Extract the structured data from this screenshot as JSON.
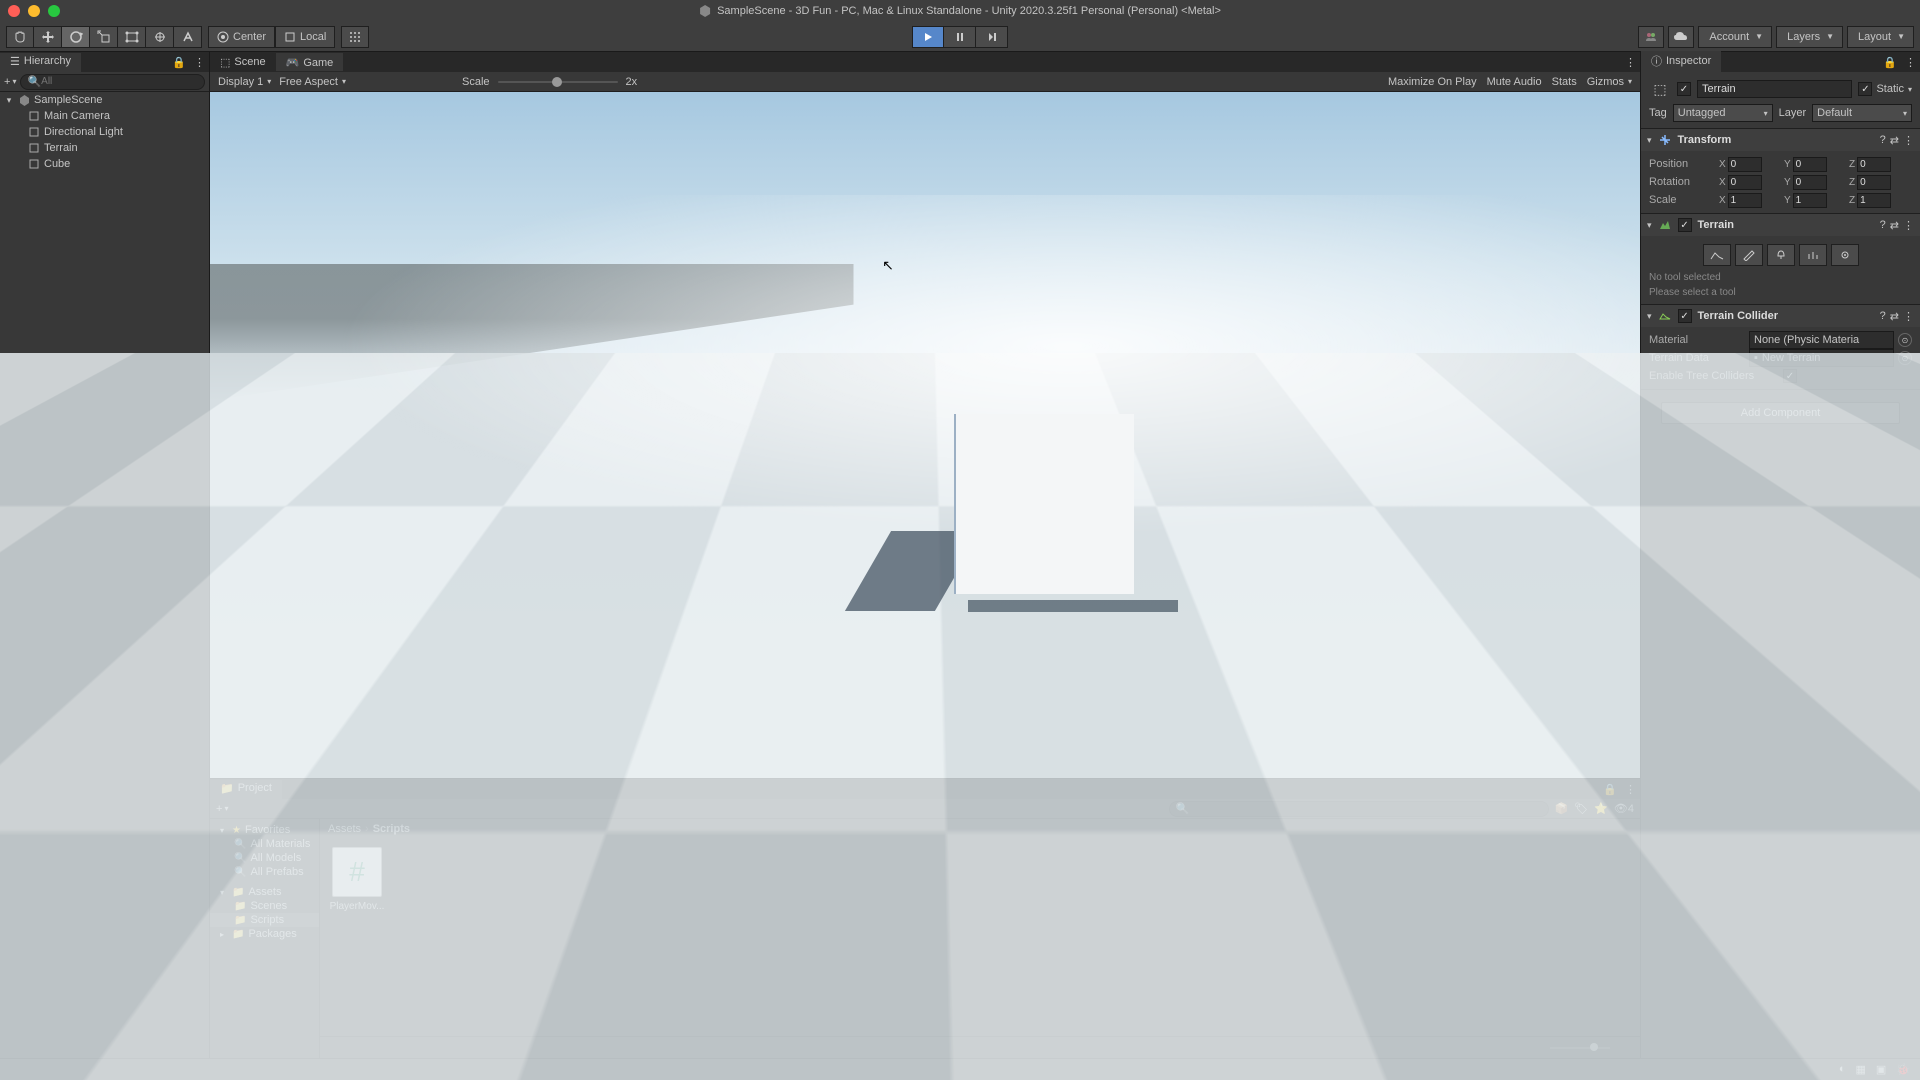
{
  "titlebar": {
    "text": "SampleScene - 3D Fun - PC, Mac & Linux Standalone - Unity 2020.3.25f1 Personal (Personal) <Metal>"
  },
  "toolbar": {
    "pivot": "Center",
    "handle": "Local",
    "account": "Account",
    "layers": "Layers",
    "layout": "Layout"
  },
  "hierarchy": {
    "title": "Hierarchy",
    "search": "All",
    "scene": "SampleScene",
    "items": [
      "Main Camera",
      "Directional Light",
      "Terrain",
      "Cube"
    ]
  },
  "viewport": {
    "scene_tab": "Scene",
    "game_tab": "Game",
    "display": "Display 1",
    "aspect": "Free Aspect",
    "scale_label": "Scale",
    "scale_value": "2x",
    "maximize": "Maximize On Play",
    "mute": "Mute Audio",
    "stats": "Stats",
    "gizmos": "Gizmos"
  },
  "project": {
    "title": "Project",
    "favorites": "Favorites",
    "fav_items": [
      "All Materials",
      "All Models",
      "All Prefabs"
    ],
    "assets": "Assets",
    "asset_folders": [
      "Scenes",
      "Scripts"
    ],
    "packages": "Packages",
    "breadcrumb": [
      "Assets",
      "Scripts"
    ],
    "files": [
      {
        "name": "PlayerMov..."
      }
    ],
    "hidden_count": "4"
  },
  "inspector": {
    "title": "Inspector",
    "object_name": "Terrain",
    "static_label": "Static",
    "tag_label": "Tag",
    "tag_value": "Untagged",
    "layer_label": "Layer",
    "layer_value": "Default",
    "transform": {
      "title": "Transform",
      "position": "Position",
      "rotation": "Rotation",
      "scale": "Scale",
      "px": "0",
      "py": "0",
      "pz": "0",
      "rx": "0",
      "ry": "0",
      "rz": "0",
      "sx": "1",
      "sy": "1",
      "sz": "1"
    },
    "terrain": {
      "title": "Terrain",
      "notool1": "No tool selected",
      "notool2": "Please select a tool"
    },
    "collider": {
      "title": "Terrain Collider",
      "material_label": "Material",
      "material_value": "None (Physic Materia",
      "data_label": "Terrain Data",
      "data_value": "New Terrain",
      "tree_label": "Enable Tree Colliders"
    },
    "add_component": "Add Component"
  }
}
